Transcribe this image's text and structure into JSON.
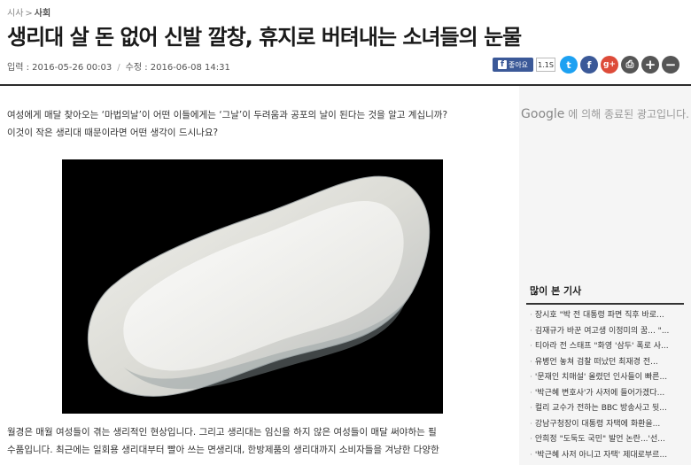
{
  "breadcrumb": {
    "parent": "시사",
    "separator": ">",
    "current": "사회"
  },
  "headline": "생리대 살 돈 없어 신발 깔창, 휴지로 버텨내는 소녀들의 눈물",
  "meta": {
    "input": "입력 : 2016-05-26 00:03",
    "divider": "/",
    "modified": "수정 : 2016-06-08 14:31"
  },
  "share": {
    "fb_like_label": "좋아요",
    "fb_like_count": "1.1S",
    "icons": [
      "twitter-icon",
      "facebook-icon",
      "google-plus-icon",
      "print-icon",
      "font-larger-icon",
      "font-smaller-icon"
    ],
    "twitter_glyph": "t",
    "facebook_glyph": "f",
    "google_glyph": "g+",
    "print_glyph": "⎙",
    "plus_glyph": "+",
    "minus_glyph": "−",
    "colors": {
      "twitter": "#1da1f2",
      "facebook": "#3b5998",
      "google": "#dd4b39",
      "dark": "#555555"
    }
  },
  "article": {
    "intro_1": "여성에게 매달 찾아오는 ‘마법의날’이 어떤 이들에게는 ‘그날’이 두려움과 공포의 날이 된다는 것을 알고 계십니까?",
    "intro_2": "이것이 작은 생리대 때문이라면 어떤 생각이 드시나요?",
    "body_1": "월경은 매월 여성들이 겪는 생리적인 현상입니다. 그리고 생리대는 임신을 하지 않은 여성들이 매달 써야하는 필",
    "body_2": "수품입니다. 최근에는 일회용 생리대부터 빨아 쓰는 면생리대, 한방제품의 생리대까지 소비자들을 겨냥한 다양한"
  },
  "ad": {
    "brand": "Google",
    "message": "에 의해 종료된 광고입니다."
  },
  "popular": {
    "title": "많이 본 기사",
    "bullet": "·",
    "items": [
      "장시호 \"박 전 대통령 파면 직후 바로...",
      "김재규가 바꾼 여고생 이정미의 꿈... \"...",
      "티아라 전 스태프 \"화영 '삼두' 폭로 사...",
      "유병언 놓쳐 검찰 떠났던 최재경 전...",
      "'문재인 치매설' 올렸던 인사들이 빠른...",
      "'박근혜 변호사'가 사저에 들어가겠다...",
      "컬리 교수가 전하는 BBC 방송사고 뒷...",
      "강남구청장이 대통령 자택에 화환을...",
      "안희정 \"도둑도 국민\" 발언 논란...'선...",
      "'박근혜 사저 아니고 자택' 제대로부르..."
    ]
  }
}
